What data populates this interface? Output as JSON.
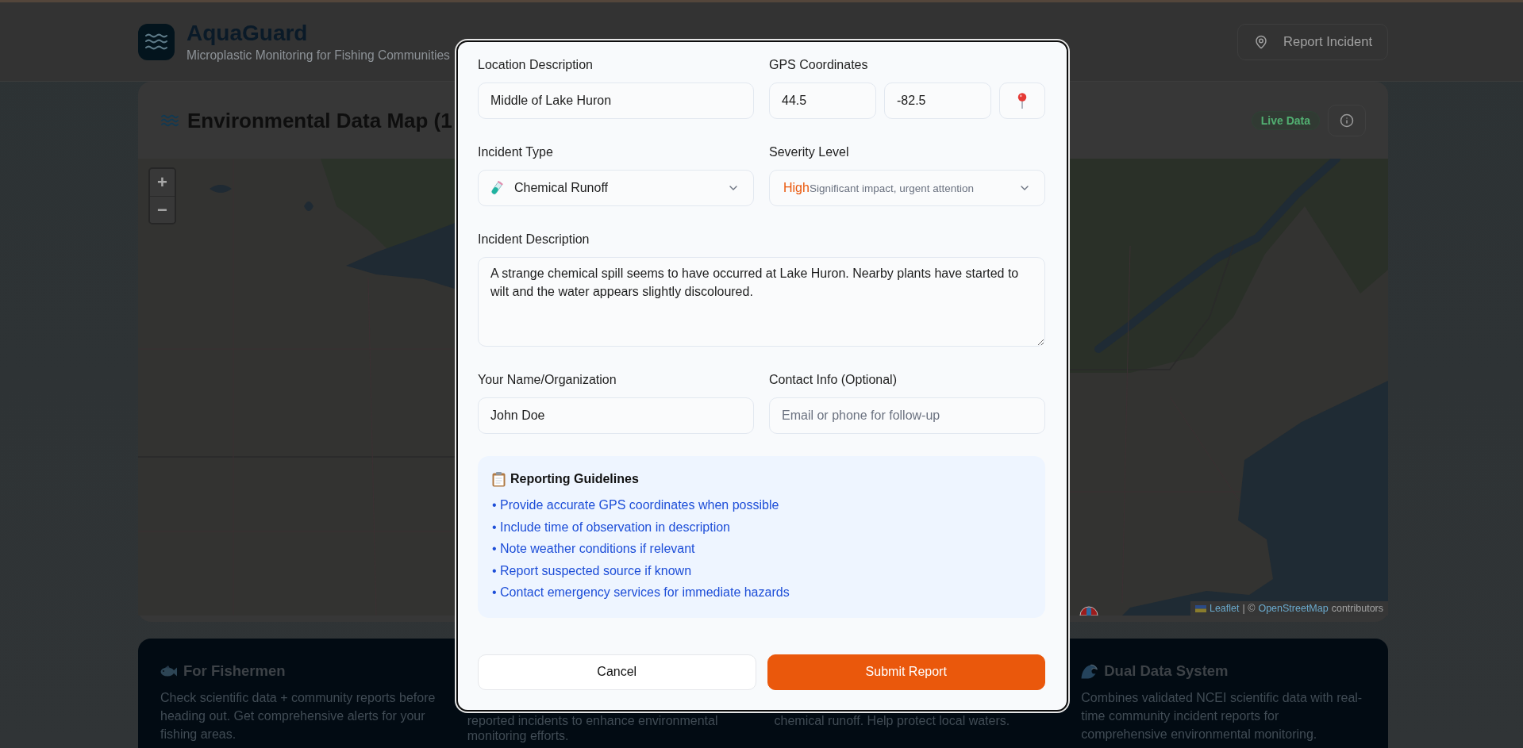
{
  "header": {
    "title": "AquaGuard",
    "subtitle": "Microplastic Monitoring for Fishing Communities",
    "report_button": "Report Incident"
  },
  "map_panel": {
    "title": "Environmental Data Map (1",
    "badge": "Live Data",
    "zoom_controls": [
      "+",
      "−"
    ],
    "attribution": [
      {
        "kind": "link",
        "text": "Leaflet"
      },
      {
        "kind": "text",
        "text": "| ©"
      },
      {
        "kind": "link",
        "text": "OpenStreetMap"
      },
      {
        "kind": "text",
        "text": "contributors"
      }
    ]
  },
  "info_cards": [
    {
      "kind": "fish",
      "title": "For Fishermen",
      "text": "Check scientific data + community reports before heading out. Get comprehensive alerts for your fishing areas."
    },
    {
      "kind": "partial",
      "text": "reported incidents to enhance environmental monitoring efforts."
    },
    {
      "kind": "partial",
      "text": "chemical runoff. Help protect local waters."
    },
    {
      "kind": "wave",
      "title": "Dual Data System",
      "text": "Combines validated NCEI scientific data with real-time community incident reports for comprehensive environmental monitoring."
    }
  ],
  "dialog": {
    "location": {
      "label": "Location Description",
      "value": "Middle of Lake Huron"
    },
    "gps": {
      "label": "GPS Coordinates",
      "latitude": "44.5",
      "longitude": "-82.5"
    },
    "incident_type": {
      "label": "Incident Type",
      "value": "Chemical Runoff"
    },
    "severity": {
      "label": "Severity Level",
      "value": "High",
      "description": "Significant impact, urgent attention"
    },
    "description": {
      "label": "Incident Description",
      "value": "A strange chemical spill seems to have occurred at Lake Huron. Nearby plants have started to wilt and the water appears slightly discoloured."
    },
    "name": {
      "label": "Your Name/Organization",
      "value": "John Doe"
    },
    "contact": {
      "label": "Contact Info (Optional)",
      "placeholder": "Email or phone for follow-up"
    },
    "guidelines": {
      "title": "Reporting Guidelines",
      "items": [
        "• Provide accurate GPS coordinates when possible",
        "• Include time of observation in description",
        "• Note weather conditions if relevant",
        "• Report suspected source if known",
        "• Contact emergency services for immediate hazards"
      ]
    },
    "buttons": [
      {
        "label": "Cancel",
        "kind": "secondary"
      },
      {
        "label": "Submit Report",
        "kind": "primary"
      }
    ]
  }
}
